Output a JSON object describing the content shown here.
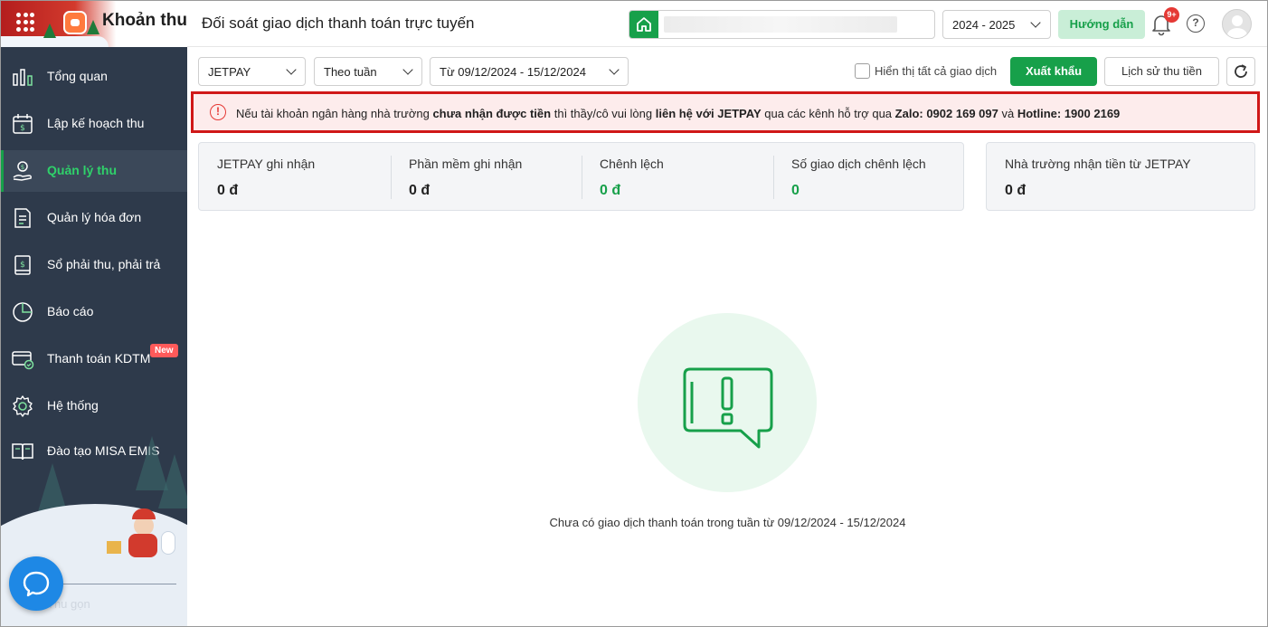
{
  "header": {
    "brand_title": "Khoản thu",
    "page_title": "Đối soát giao dịch thanh toán trực tuyến",
    "school_year": "2024 - 2025",
    "guide_label": "Hướng dẫn",
    "notification_count": "9+"
  },
  "sidebar": {
    "items": [
      {
        "label": "Tổng quan",
        "icon": "bar-chart-icon"
      },
      {
        "label": "Lập kế hoạch thu",
        "icon": "calendar-money-icon"
      },
      {
        "label": "Quản lý thu",
        "icon": "hand-coin-icon",
        "active": true
      },
      {
        "label": "Quản lý hóa đơn",
        "icon": "invoice-icon"
      },
      {
        "label": "Sổ phải thu, phải trả",
        "icon": "ledger-icon"
      },
      {
        "label": "Báo cáo",
        "icon": "pie-chart-icon"
      },
      {
        "label": "Thanh toán KDTM",
        "icon": "card-check-icon",
        "badge": "New"
      },
      {
        "label": "Hệ thống",
        "icon": "gear-icon"
      },
      {
        "label": "Đào tạo MISA EMIS",
        "icon": "book-icon"
      }
    ],
    "collapse_label": "Thu gọn"
  },
  "toolbar": {
    "provider": "JETPAY",
    "period": "Theo tuần",
    "date_range": "Từ 09/12/2024 - 15/12/2024",
    "show_all_label": "Hiển thị tất cả giao dịch",
    "show_all_checked": false,
    "export_label": "Xuất khẩu",
    "history_label": "Lịch sử thu tiền"
  },
  "alert": {
    "p1": "Nếu tài khoản ngân hàng nhà trường ",
    "b1": "chưa nhận được tiền",
    "p2": " thì thầy/cô vui lòng ",
    "b2": "liên hệ với JETPAY",
    "p3": " qua các kênh hỗ trợ qua ",
    "b3": "Zalo: 0902 169 097",
    "p4": " và ",
    "b4": "Hotline: 1900 2169"
  },
  "stats": [
    {
      "label": "JETPAY ghi nhận",
      "value": "0 đ"
    },
    {
      "label": "Phần mềm ghi nhận",
      "value": "0 đ"
    },
    {
      "label": "Chênh lệch",
      "value": "0 đ"
    },
    {
      "label": "Số giao dịch chênh lệch",
      "value": "0"
    }
  ],
  "school_received": {
    "label": "Nhà trường nhận tiền từ JETPAY",
    "value": "0 đ"
  },
  "empty_state": {
    "message": "Chưa có giao dịch thanh toán trong tuần từ 09/12/2024 - 15/12/2024"
  },
  "colors": {
    "accent": "#17a04a",
    "sidebar": "#2e3a4b",
    "alert_border": "#d01818",
    "alert_bg": "#fdecec"
  }
}
